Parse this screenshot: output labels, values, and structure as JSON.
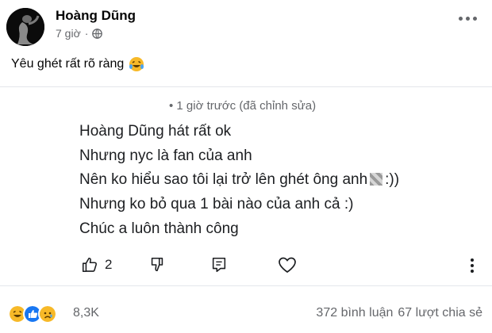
{
  "post": {
    "author": "Hoàng Dũng",
    "time": "7 giờ",
    "separator": "·",
    "caption": "Yêu ghét rất rõ ràng"
  },
  "comment": {
    "time": "• 1 giờ trước (đã chỉnh sửa)",
    "lines": [
      "Hoàng Dũng hát rất ok",
      "Nhưng nyc là fan của anh",
      "Nên ko hiểu sao tôi lại trở lên ghét ông anh",
      "Nhưng ko bỏ qua 1 bài nào của anh cả :)",
      "Chúc a luôn thành công"
    ],
    "line3_suffix": ":))",
    "like_count": "2"
  },
  "footer": {
    "reaction_count": "8,3K",
    "comments": "372 bình luận",
    "shares": "67 lượt chia sẻ"
  },
  "icons": {
    "privacy": "globe-icon",
    "caption_emoji": "laughing-tears-emoji-icon",
    "more": "more-options-icon"
  },
  "colors": {
    "secondary_text": "#65676b",
    "like_blue": "#1877f2",
    "haha_yellow": "#f7b928"
  }
}
